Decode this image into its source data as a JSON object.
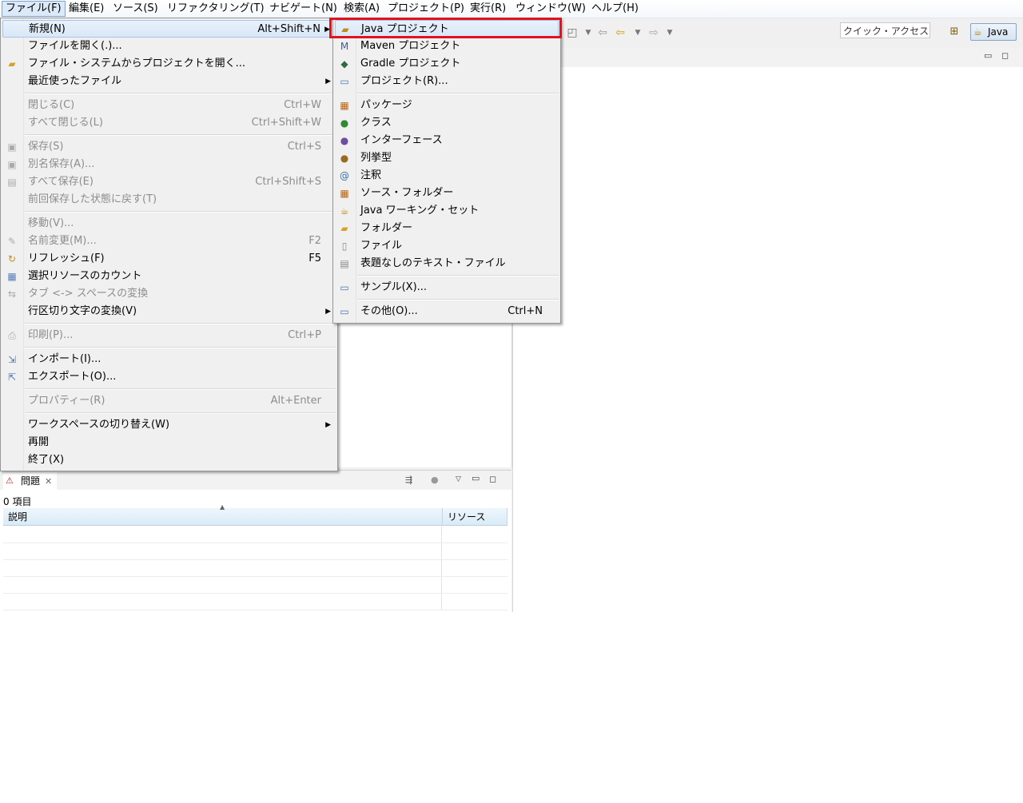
{
  "menubar": [
    {
      "label": "ファイル(F)"
    },
    {
      "label": "編集(E)"
    },
    {
      "label": "ソース(S)"
    },
    {
      "label": "リファクタリング(T)"
    },
    {
      "label": "ナビゲート(N)"
    },
    {
      "label": "検索(A)"
    },
    {
      "label": "プロジェクト(P)"
    },
    {
      "label": "実行(R)"
    },
    {
      "label": "ウィンドウ(W)"
    },
    {
      "label": "ヘルプ(H)"
    }
  ],
  "toolbar": {
    "quick_access": "クイック・アクセス",
    "perspective": "Java"
  },
  "file_menu": [
    {
      "label": "新規(N)",
      "shortcut": "Alt+Shift+N",
      "submenu": true,
      "icon": "none",
      "state": "highlighted"
    },
    {
      "label": "ファイルを開く(.)...",
      "shortcut": "",
      "icon": "none"
    },
    {
      "label": "ファイル・システムからプロジェクトを開く...",
      "shortcut": "",
      "icon": "folder-open-icon"
    },
    {
      "label": "最近使ったファイル",
      "shortcut": "",
      "submenu": true,
      "icon": "none"
    },
    {
      "label": "閉じる(C)",
      "shortcut": "Ctrl+W",
      "disabled": true
    },
    {
      "label": "すべて閉じる(L)",
      "shortcut": "Ctrl+Shift+W",
      "disabled": true
    },
    {
      "label": "保存(S)",
      "shortcut": "Ctrl+S",
      "disabled": true,
      "icon": "save-icon"
    },
    {
      "label": "別名保存(A)...",
      "shortcut": "",
      "disabled": true,
      "icon": "save-as-icon"
    },
    {
      "label": "すべて保存(E)",
      "shortcut": "Ctrl+Shift+S",
      "disabled": true,
      "icon": "save-all-icon"
    },
    {
      "label": "前回保存した状態に戻す(T)",
      "shortcut": "",
      "disabled": true
    },
    {
      "label": "移動(V)...",
      "shortcut": "",
      "disabled": true
    },
    {
      "label": "名前変更(M)...",
      "shortcut": "F2",
      "disabled": true,
      "icon": "rename-icon"
    },
    {
      "label": "リフレッシュ(F)",
      "shortcut": "F5",
      "icon": "refresh-icon"
    },
    {
      "label": "選択リソースのカウント",
      "shortcut": "",
      "icon": "count-icon"
    },
    {
      "label": "タブ <-> スペースの変換",
      "shortcut": "",
      "disabled": true,
      "icon": "convert-icon"
    },
    {
      "label": "行区切り文字の変換(V)",
      "shortcut": "",
      "submenu": true
    },
    {
      "label": "印刷(P)...",
      "shortcut": "Ctrl+P",
      "disabled": true,
      "icon": "print-icon"
    },
    {
      "label": "インポート(I)...",
      "shortcut": "",
      "icon": "import-icon"
    },
    {
      "label": "エクスポート(O)...",
      "shortcut": "",
      "icon": "export-icon"
    },
    {
      "label": "プロパティー(R)",
      "shortcut": "Alt+Enter",
      "disabled": true
    },
    {
      "label": "ワークスペースの切り替え(W)",
      "shortcut": "",
      "submenu": true
    },
    {
      "label": "再開",
      "shortcut": ""
    },
    {
      "label": "終了(X)",
      "shortcut": ""
    }
  ],
  "new_submenu": [
    {
      "label": "Java プロジェクト",
      "shortcut": "",
      "icon": "java-project-icon",
      "state": "highlighted"
    },
    {
      "label": "Maven プロジェクト",
      "shortcut": "",
      "icon": "maven-project-icon"
    },
    {
      "label": "Gradle プロジェクト",
      "shortcut": "",
      "icon": "gradle-project-icon"
    },
    {
      "label": "プロジェクト(R)...",
      "shortcut": "",
      "icon": "project-icon"
    },
    {
      "label": "パッケージ",
      "shortcut": "",
      "icon": "package-icon"
    },
    {
      "label": "クラス",
      "shortcut": "",
      "icon": "class-icon"
    },
    {
      "label": "インターフェース",
      "shortcut": "",
      "icon": "interface-icon"
    },
    {
      "label": "列挙型",
      "shortcut": "",
      "icon": "enum-icon"
    },
    {
      "label": "注釈",
      "shortcut": "",
      "icon": "annotation-icon"
    },
    {
      "label": "ソース・フォルダー",
      "shortcut": "",
      "icon": "source-folder-icon"
    },
    {
      "label": "Java ワーキング・セット",
      "shortcut": "",
      "icon": "working-set-icon"
    },
    {
      "label": "フォルダー",
      "shortcut": "",
      "icon": "folder-icon"
    },
    {
      "label": "ファイル",
      "shortcut": "",
      "icon": "file-icon"
    },
    {
      "label": "表題なしのテキスト・ファイル",
      "shortcut": "",
      "icon": "text-file-icon"
    },
    {
      "label": "サンプル(X)...",
      "shortcut": "",
      "icon": "sample-icon"
    },
    {
      "label": "その他(O)...",
      "shortcut": "Ctrl+N",
      "icon": "other-icon"
    }
  ],
  "problems": {
    "tab_label": "問題",
    "count": "0 項目",
    "columns": [
      "説明",
      "リソース"
    ]
  },
  "colors": {
    "highlight_box": "#e0131e",
    "menu_bg": "#f0f0f0",
    "disabled_text": "#8d8d8d"
  }
}
